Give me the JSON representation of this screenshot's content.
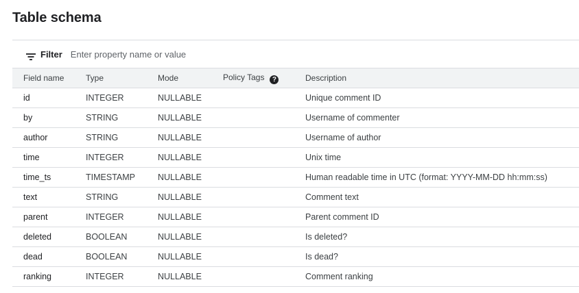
{
  "page": {
    "title": "Table schema"
  },
  "filter": {
    "icon": "filter-list-icon",
    "label": "Filter",
    "placeholder": "Enter property name or value"
  },
  "table": {
    "headers": {
      "field_name": "Field name",
      "type": "Type",
      "mode": "Mode",
      "policy_tags": "Policy Tags",
      "description": "Description"
    },
    "policy_tags_icon": "help-icon",
    "rows": [
      {
        "field_name": "id",
        "type": "INTEGER",
        "mode": "NULLABLE",
        "policy_tags": "",
        "description": "Unique comment ID"
      },
      {
        "field_name": "by",
        "type": "STRING",
        "mode": "NULLABLE",
        "policy_tags": "",
        "description": "Username of commenter"
      },
      {
        "field_name": "author",
        "type": "STRING",
        "mode": "NULLABLE",
        "policy_tags": "",
        "description": "Username of author"
      },
      {
        "field_name": "time",
        "type": "INTEGER",
        "mode": "NULLABLE",
        "policy_tags": "",
        "description": "Unix time"
      },
      {
        "field_name": "time_ts",
        "type": "TIMESTAMP",
        "mode": "NULLABLE",
        "policy_tags": "",
        "description": "Human readable time in UTC (format: YYYY-MM-DD hh:mm:ss)"
      },
      {
        "field_name": "text",
        "type": "STRING",
        "mode": "NULLABLE",
        "policy_tags": "",
        "description": "Comment text"
      },
      {
        "field_name": "parent",
        "type": "INTEGER",
        "mode": "NULLABLE",
        "policy_tags": "",
        "description": "Parent comment ID"
      },
      {
        "field_name": "deleted",
        "type": "BOOLEAN",
        "mode": "NULLABLE",
        "policy_tags": "",
        "description": "Is deleted?"
      },
      {
        "field_name": "dead",
        "type": "BOOLEAN",
        "mode": "NULLABLE",
        "policy_tags": "",
        "description": "Is dead?"
      },
      {
        "field_name": "ranking",
        "type": "INTEGER",
        "mode": "NULLABLE",
        "policy_tags": "",
        "description": "Comment ranking"
      }
    ]
  },
  "colors": {
    "text": "#202124",
    "secondary_text": "#3c4043",
    "header_bg": "#f1f3f4",
    "border": "#dadce0"
  }
}
